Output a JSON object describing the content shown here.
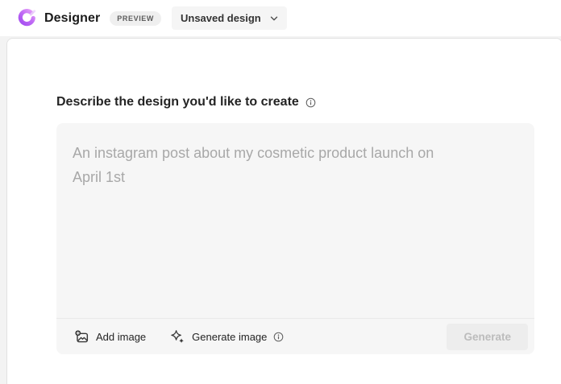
{
  "header": {
    "app_name": "Designer",
    "preview_badge": "PREVIEW",
    "design_menu_label": "Unsaved design"
  },
  "main": {
    "heading": "Describe the design you'd like to create",
    "prompt": {
      "value": "",
      "placeholder": "An instagram post about my cosmetic product launch on April 1st"
    },
    "toolbar": {
      "add_image_label": "Add image",
      "generate_image_label": "Generate image",
      "generate_label": "Generate"
    }
  },
  "icons": {
    "logo": "designer-logo",
    "info": "info-icon",
    "chevron": "chevron-down-icon",
    "add_image": "add-image-icon",
    "generate_image": "sparkle-icon"
  },
  "colors": {
    "brand_gradient_top": "#dd8df7",
    "brand_gradient_bottom": "#9b4dee",
    "page_background": "#f3f3f3",
    "card_background": "#ffffff",
    "prompt_background": "#f6f6f6",
    "placeholder_text": "#a8a8a8",
    "body_text": "#242424",
    "disabled_button_bg": "#ededed",
    "disabled_button_text": "#bcbcbc"
  }
}
